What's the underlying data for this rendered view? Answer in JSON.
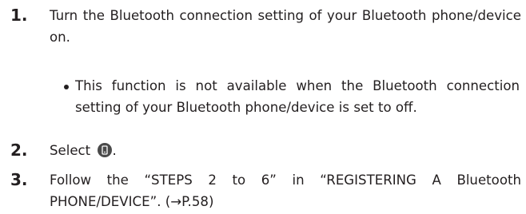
{
  "steps": [
    {
      "number": "1.",
      "text": "Turn the Bluetooth connection setting of your Bluetooth phone/device on."
    },
    {
      "number": "2.",
      "text": "Select",
      "trailing": "."
    },
    {
      "number": "3.",
      "text": "Follow the “STEPS 2 to 6” in “REGISTERING A Bluetooth PHONE/DEVICE”. (→P.58)"
    }
  ],
  "note": "This function is not available when the Bluetooth connection setting of your Bluetooth phone/device is set to off.",
  "icons": {
    "select_button": "phone-device-icon"
  }
}
